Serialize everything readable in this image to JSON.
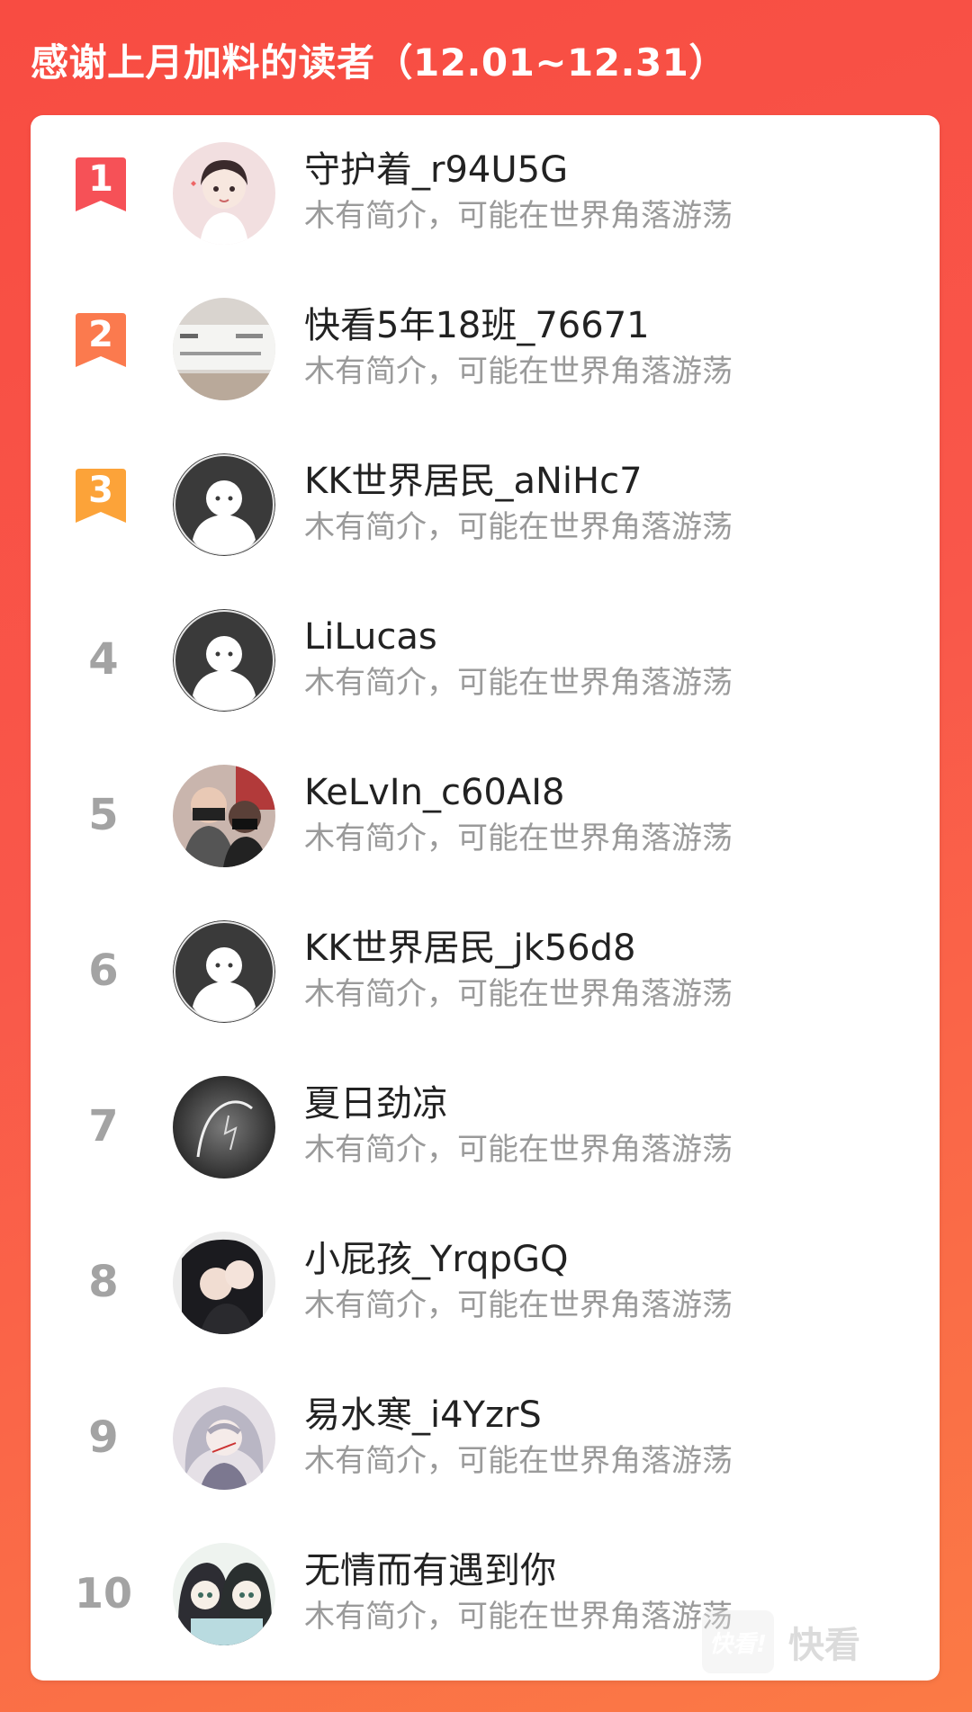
{
  "header": {
    "title": "感谢上月加料的读者（12.01~12.31）"
  },
  "colors": {
    "rank1": "#f65157",
    "rank2": "#fb7a4e",
    "rank3": "#fca339",
    "rank_other": "#a3a3a3",
    "bio": "#9a9a9a"
  },
  "readers": [
    {
      "rank": "1",
      "name": "守护着_r94U5G",
      "bio": "木有简介，可能在世界角落游荡",
      "avatar": "anime-boy-avatar"
    },
    {
      "rank": "2",
      "name": "快看5年18班_76671",
      "bio": "木有简介，可能在世界角落游荡",
      "avatar": "document-photo-avatar"
    },
    {
      "rank": "3",
      "name": "KK世界居民_aNiHc7",
      "bio": "木有简介，可能在世界角落游荡",
      "avatar": "default-avatar"
    },
    {
      "rank": "4",
      "name": "LiLucas",
      "bio": "木有简介，可能在世界角落游荡",
      "avatar": "default-avatar"
    },
    {
      "rank": "5",
      "name": "KeLvIn_c60AI8",
      "bio": "木有简介，可能在世界角落游荡",
      "avatar": "couple-photo-avatar"
    },
    {
      "rank": "6",
      "name": "KK世界居民_jk56d8",
      "bio": "木有简介，可能在世界角落游荡",
      "avatar": "default-avatar"
    },
    {
      "rank": "7",
      "name": "夏日劲凉",
      "bio": "木有简介，可能在世界角落游荡",
      "avatar": "lightning-avatar"
    },
    {
      "rank": "8",
      "name": "小屁孩_YrqpGQ",
      "bio": "木有简介，可能在世界角落游荡",
      "avatar": "couple-anime-avatar"
    },
    {
      "rank": "9",
      "name": "易水寒_i4YzrS",
      "bio": "木有简介，可能在世界角落游荡",
      "avatar": "silver-hair-anime-avatar"
    },
    {
      "rank": "10",
      "name": "无情而有遇到你",
      "bio": "木有简介，可能在世界角落游荡",
      "avatar": "anime-girls-avatar"
    }
  ],
  "watermark": {
    "badge": "快看!",
    "text": "快看"
  }
}
